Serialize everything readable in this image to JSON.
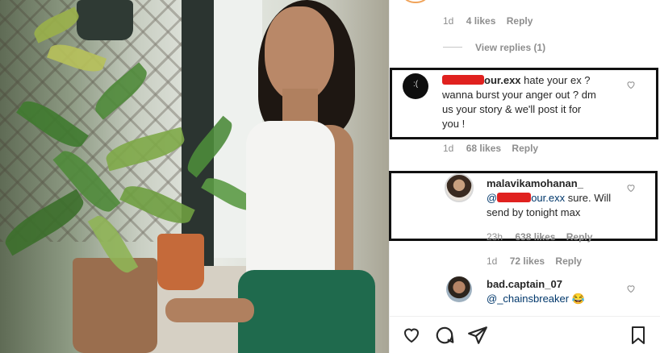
{
  "post_image": {
    "alt": "photo"
  },
  "comments_panel": {
    "top_reply_meta": {
      "time": "1d",
      "likes": "4 likes",
      "reply": "Reply"
    },
    "view_replies": "View replies (1)",
    "comment1": {
      "username_suffix": "our.exx",
      "text_line1": " hate your ex ?",
      "text_line2": "wanna burst your anger out ? dm",
      "text_line3": "us your story & we'll post it for",
      "text_line4": "you !",
      "time": "1d",
      "likes": "68 likes",
      "reply": "Reply"
    },
    "comment2": {
      "username": "malavikamohanan_",
      "mention_prefix": "@",
      "mention_suffix": "our.exx",
      "text_line1": " sure. Will",
      "text_line2": "send by tonight max",
      "time": "23h",
      "likes": "638 likes",
      "reply": "Reply"
    },
    "comment2_reply_meta": {
      "time": "1d",
      "likes": "72 likes",
      "reply": "Reply"
    },
    "comment3": {
      "username": "bad.captain_07",
      "mention": "@_chainsbreaker",
      "emoji": "😂"
    }
  },
  "actions": {
    "icons": [
      "heart-icon",
      "comment-icon",
      "share-icon",
      "bookmark-icon"
    ]
  },
  "colors": {
    "redaction": "#e0211f",
    "mention": "#00376b",
    "muted": "#8e8e8e"
  }
}
